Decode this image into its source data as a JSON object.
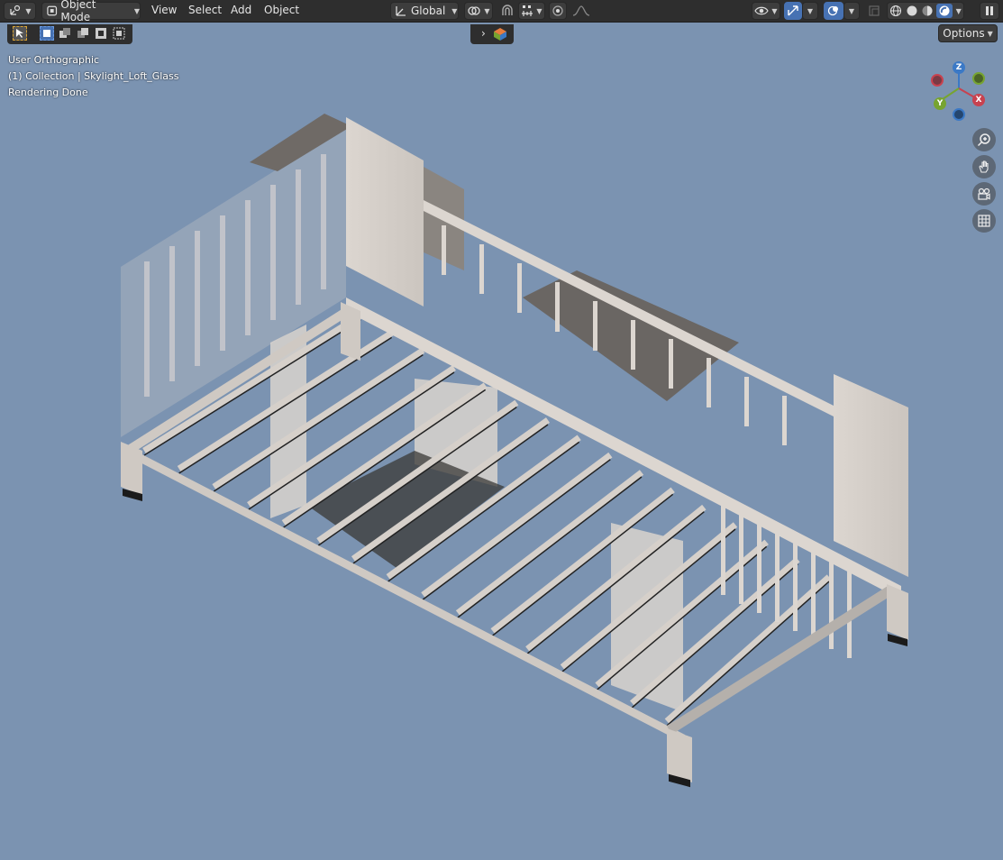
{
  "header": {
    "editor_type_icon": "3d-viewport-icon",
    "mode_label": "Object Mode",
    "menus": [
      "View",
      "Select",
      "Add",
      "Object"
    ],
    "transform_orientation": "Global",
    "snap_icon": "magnet-icon",
    "proportional_icon": "proportional-editing-icon"
  },
  "toolbar": {
    "options_label": "Options"
  },
  "viewport": {
    "view_name": "User Orthographic",
    "collection_line": "(1) Collection | Skylight_Loft_Glass",
    "status": "Rendering Done",
    "background": "#7b93b1"
  },
  "gizmo": {
    "z": "Z",
    "y": "Y",
    "x": "X"
  },
  "colors": {
    "x_axis": "#c8424f",
    "y_axis": "#77a431",
    "z_axis": "#3b79c6",
    "active_button": "#4772b3"
  }
}
